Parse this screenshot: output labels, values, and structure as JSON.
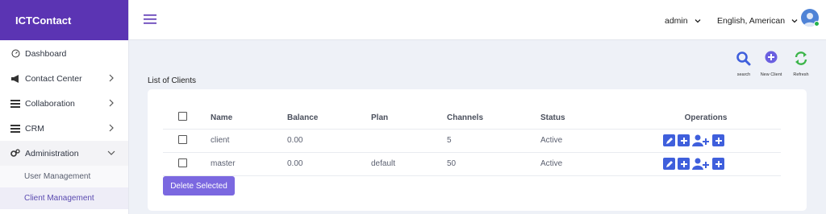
{
  "brand": "ICTContact",
  "sidebar": {
    "items": [
      {
        "label": "Dashboard",
        "icon": "dashboard-gauge-icon"
      },
      {
        "label": "Contact Center",
        "icon": "megaphone-icon"
      },
      {
        "label": "Collaboration",
        "icon": "list-icon"
      },
      {
        "label": "CRM",
        "icon": "list-icon"
      },
      {
        "label": "Administration",
        "icon": "cogs-icon"
      }
    ],
    "sub_items": [
      {
        "label": "User Management"
      },
      {
        "label": "Client Management"
      }
    ]
  },
  "topbar": {
    "user": "admin",
    "language": "English, American"
  },
  "toolbar": {
    "search_label": "search",
    "new_client_label": "New Client",
    "refresh_label": "Refresh"
  },
  "section_title": "List of Clients",
  "table": {
    "headers": [
      "Name",
      "Balance",
      "Plan",
      "Channels",
      "Status",
      "Operations"
    ],
    "rows": [
      {
        "name": "client",
        "balance": "0.00",
        "plan": "",
        "channels": "5",
        "status": "Active"
      },
      {
        "name": "master",
        "balance": "0.00",
        "plan": "default",
        "channels": "50",
        "status": "Active"
      }
    ]
  },
  "delete_label": "Delete Selected",
  "colors": {
    "brand": "#5b34b3",
    "accent": "#3f5fdc",
    "button": "#7b68e0",
    "refresh": "#3cb54a"
  }
}
